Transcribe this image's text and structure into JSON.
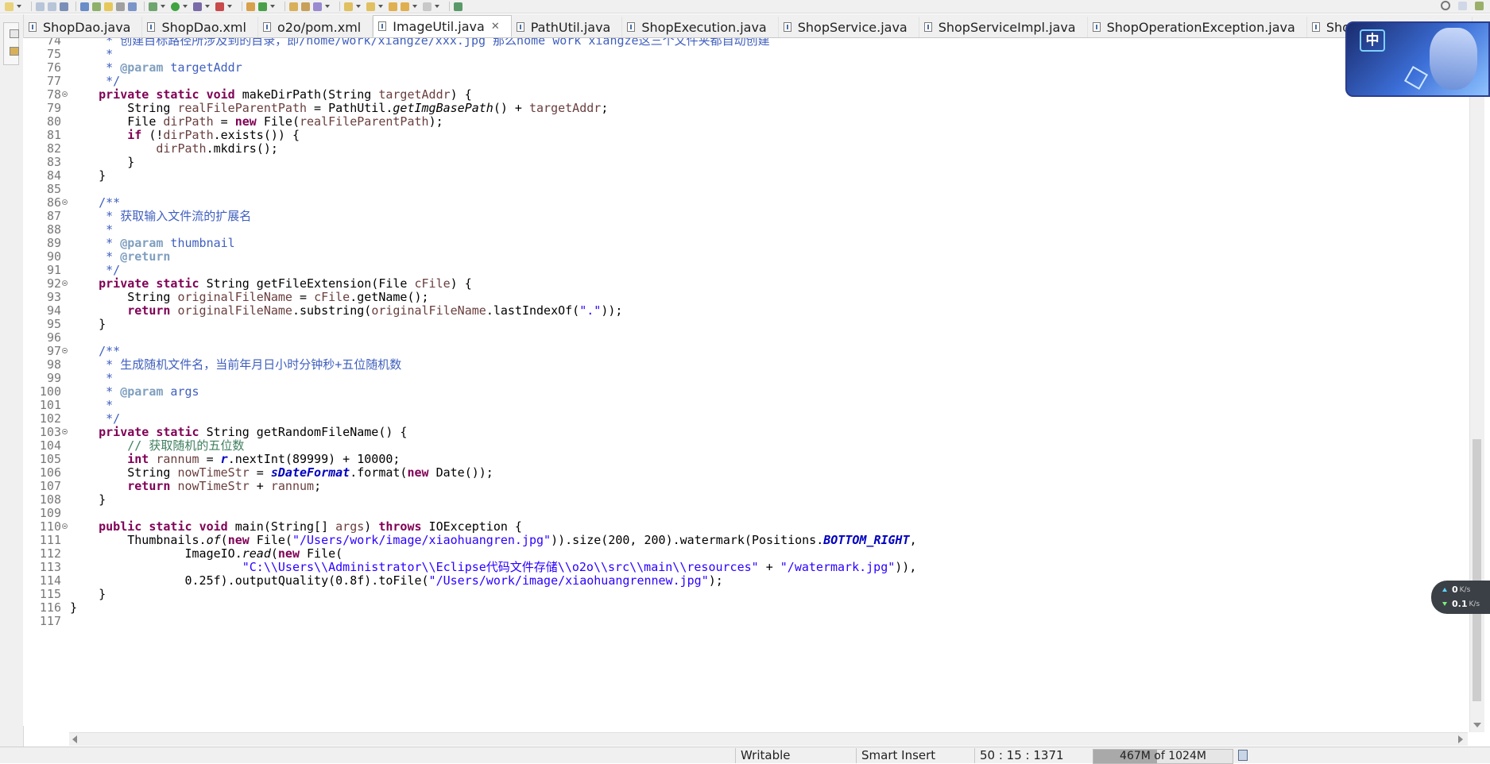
{
  "tabs": [
    {
      "label": "ShopDao.java",
      "icon": "java-file-icon",
      "active": false
    },
    {
      "label": "ShopDao.xml",
      "icon": "xml-file-icon",
      "active": false
    },
    {
      "label": "o2o/pom.xml",
      "icon": "maven-file-icon",
      "active": false
    },
    {
      "label": "ImageUtil.java",
      "icon": "java-file-icon",
      "active": true,
      "close": "✕"
    },
    {
      "label": "PathUtil.java",
      "icon": "java-file-icon",
      "active": false
    },
    {
      "label": "ShopExecution.java",
      "icon": "java-file-icon",
      "active": false
    },
    {
      "label": "ShopService.java",
      "icon": "java-file-icon",
      "active": false
    },
    {
      "label": "ShopServiceImpl.java",
      "icon": "java-file-icon",
      "active": false
    },
    {
      "label": "ShopOperationException.java",
      "icon": "java-file-icon",
      "active": false
    },
    {
      "label": "ShopServiceTest.java",
      "icon": "java-file-icon",
      "active": false
    }
  ],
  "editor": {
    "lines": [
      {
        "n": "74",
        "fold": false,
        "html": "     <span class=\"cm\">* 创建目标路径所涉及到的目录，即/home/work/xiangze/xxx.jpg 那么home work xiangze这三个文件夹都自动创建</span>"
      },
      {
        "n": "75",
        "fold": false,
        "html": "     <span class=\"cm\">*</span>"
      },
      {
        "n": "76",
        "fold": false,
        "html": "     <span class=\"cm\">* </span><span class=\"tg\">@param</span><span class=\"cm\"> targetAddr</span>"
      },
      {
        "n": "77",
        "fold": false,
        "html": "     <span class=\"cm\">*/</span>"
      },
      {
        "n": "78",
        "fold": true,
        "html": "    <span class=\"kw\">private</span> <span class=\"kw\">static</span> <span class=\"kw\">void</span> makeDirPath(String <span class=\"pm\">targetAddr</span>) {"
      },
      {
        "n": "79",
        "fold": false,
        "html": "        String <span class=\"lv\">realFileParentPath</span> = PathUtil.<span class=\"it\">getImgBasePath</span>() + <span class=\"pm\">targetAddr</span>;"
      },
      {
        "n": "80",
        "fold": false,
        "html": "        File <span class=\"lv\">dirPath</span> = <span class=\"kw\">new</span> File(<span class=\"lv\">realFileParentPath</span>);"
      },
      {
        "n": "81",
        "fold": false,
        "html": "        <span class=\"kw\">if</span> (!<span class=\"lv\">dirPath</span>.exists()) {"
      },
      {
        "n": "82",
        "fold": false,
        "html": "            <span class=\"lv\">dirPath</span>.mkdirs();"
      },
      {
        "n": "83",
        "fold": false,
        "html": "        }"
      },
      {
        "n": "84",
        "fold": false,
        "html": "    }"
      },
      {
        "n": "85",
        "fold": false,
        "html": ""
      },
      {
        "n": "86",
        "fold": true,
        "html": "    <span class=\"cm\">/**</span>"
      },
      {
        "n": "87",
        "fold": false,
        "html": "     <span class=\"cm\">* 获取输入文件流的扩展名</span>"
      },
      {
        "n": "88",
        "fold": false,
        "html": "     <span class=\"cm\">*</span>"
      },
      {
        "n": "89",
        "fold": false,
        "html": "     <span class=\"cm\">* </span><span class=\"tg\">@param</span><span class=\"cm\"> thumbnail</span>"
      },
      {
        "n": "90",
        "fold": false,
        "html": "     <span class=\"cm\">* </span><span class=\"tg\">@return</span>"
      },
      {
        "n": "91",
        "fold": false,
        "html": "     <span class=\"cm\">*/</span>"
      },
      {
        "n": "92",
        "fold": true,
        "html": "    <span class=\"kw\">private</span> <span class=\"kw\">static</span> String getFileExtension(File <span class=\"pm\">cFile</span>) {"
      },
      {
        "n": "93",
        "fold": false,
        "html": "        String <span class=\"lv\">originalFileName</span> = <span class=\"pm\">cFile</span>.getName();"
      },
      {
        "n": "94",
        "fold": false,
        "html": "        <span class=\"kw\">return</span> <span class=\"lv\">originalFileName</span>.substring(<span class=\"lv\">originalFileName</span>.lastIndexOf(<span class=\"str\">\".\"</span>));"
      },
      {
        "n": "95",
        "fold": false,
        "html": "    }"
      },
      {
        "n": "96",
        "fold": false,
        "html": ""
      },
      {
        "n": "97",
        "fold": true,
        "html": "    <span class=\"cm\">/**</span>"
      },
      {
        "n": "98",
        "fold": false,
        "html": "     <span class=\"cm\">* 生成随机文件名，当前年月日小时分钟秒+五位随机数</span>"
      },
      {
        "n": "99",
        "fold": false,
        "html": "     <span class=\"cm\">*</span>"
      },
      {
        "n": "100",
        "fold": false,
        "html": "     <span class=\"cm\">* </span><span class=\"tg\">@param</span><span class=\"cm\"> args</span>"
      },
      {
        "n": "101",
        "fold": false,
        "html": "     <span class=\"cm\">*</span>"
      },
      {
        "n": "102",
        "fold": false,
        "html": "     <span class=\"cm\">*/</span>"
      },
      {
        "n": "103",
        "fold": true,
        "html": "    <span class=\"kw\">private</span> <span class=\"kw\">static</span> String getRandomFileName() {"
      },
      {
        "n": "104",
        "fold": false,
        "html": "        <span class=\"lc\">// 获取随机的五位数</span>"
      },
      {
        "n": "105",
        "fold": false,
        "html": "        <span class=\"kw\">int</span> <span class=\"lv\">rannum</span> = <span class=\"fld\">r</span>.nextInt(89999) + 10000;"
      },
      {
        "n": "106",
        "fold": false,
        "html": "        String <span class=\"lv\">nowTimeStr</span> = <span class=\"fld\">sDateFormat</span>.format(<span class=\"kw\">new</span> Date());"
      },
      {
        "n": "107",
        "fold": false,
        "html": "        <span class=\"kw\">return</span> <span class=\"lv\">nowTimeStr</span> + <span class=\"lv\">rannum</span>;"
      },
      {
        "n": "108",
        "fold": false,
        "html": "    }"
      },
      {
        "n": "109",
        "fold": false,
        "html": ""
      },
      {
        "n": "110",
        "fold": true,
        "html": "    <span class=\"kw\">public</span> <span class=\"kw\">static</span> <span class=\"kw\">void</span> main(String[] <span class=\"pm\">args</span>) <span class=\"kw\">throws</span> IOException {"
      },
      {
        "n": "111",
        "fold": false,
        "html": "        Thumbnails.<span class=\"it\">of</span>(<span class=\"kw\">new</span> File(<span class=\"str\">\"/Users/work/image/xiaohuangren.jpg\"</span>)).size(200, 200).watermark(Positions.<span class=\"fld\">BOTTOM_RIGHT</span>,"
      },
      {
        "n": "112",
        "fold": false,
        "html": "                ImageIO.<span class=\"it\">read</span>(<span class=\"kw\">new</span> File("
      },
      {
        "n": "113",
        "fold": false,
        "html": "                        <span class=\"str\">\"C:\\\\Users\\\\Administrator\\\\Eclipse代码文件存储\\\\o2o\\\\src\\\\main\\\\resources\"</span> + <span class=\"str\">\"/watermark.jpg\"</span>)),"
      },
      {
        "n": "114",
        "fold": false,
        "html": "                0.25f).outputQuality(0.8f).toFile(<span class=\"str\">\"/Users/work/image/xiaohuangrennew.jpg\"</span>);"
      },
      {
        "n": "115",
        "fold": false,
        "html": "    }"
      },
      {
        "n": "116",
        "fold": false,
        "html": "}"
      },
      {
        "n": "117",
        "fold": false,
        "html": ""
      }
    ]
  },
  "status": {
    "mode": "Writable",
    "insert": "Smart Insert",
    "position": "50 : 15 : 1371",
    "heap": "467M of 1024M",
    "heap_used_fraction": 0.456
  },
  "overlay": {
    "ime_badge": "中",
    "net_up": "0",
    "net_up_unit": "K/s",
    "net_down": "0.1",
    "net_down_unit": "K/s"
  },
  "colors": {
    "keyword": "#7f0055",
    "comment": "#3f5fbf",
    "javadoc_tag": "#7f9fbf",
    "line_comment": "#3f7f5f",
    "string": "#2a00ff",
    "static_field": "#0000c0",
    "local_var": "#6a3e3e"
  }
}
